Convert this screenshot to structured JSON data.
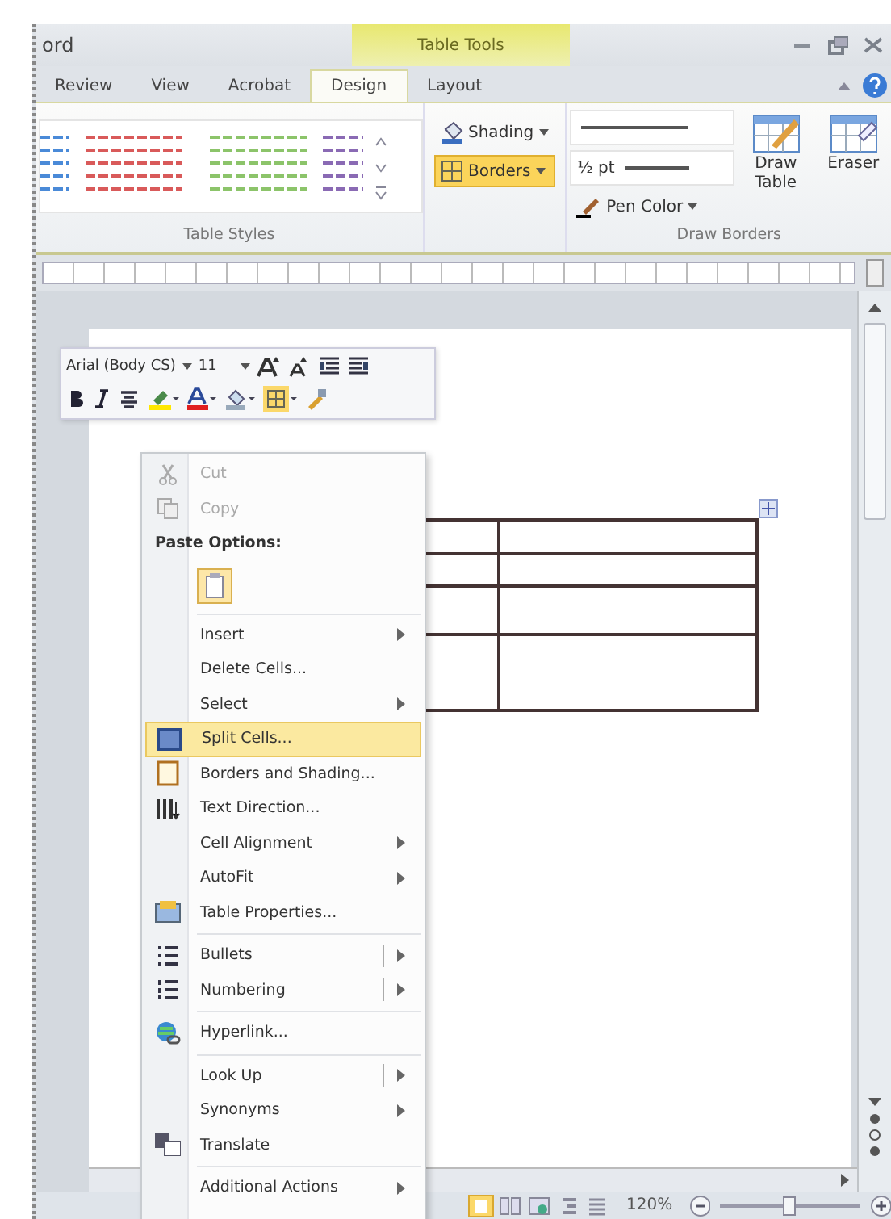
{
  "window": {
    "title": "ord",
    "context_tab": "Table Tools"
  },
  "tabs": [
    {
      "label": "Review",
      "selected": false
    },
    {
      "label": "View",
      "selected": false
    },
    {
      "label": "Acrobat",
      "selected": false
    },
    {
      "label": "Design",
      "selected": true
    },
    {
      "label": "Layout",
      "selected": false
    }
  ],
  "ribbon": {
    "table_styles_label": "Table Styles",
    "shading": {
      "label": "Shading",
      "selected": false
    },
    "borders": {
      "label": "Borders",
      "selected": true
    },
    "pen_weight": "½ pt",
    "pen_color": "Pen Color",
    "draw_table": "Draw Table",
    "eraser": "Eraser",
    "draw_borders_label": "Draw Borders"
  },
  "mini_toolbar": {
    "font": "Arial (Body CS)",
    "size": "11"
  },
  "context_menu": [
    {
      "kind": "item",
      "label": "Cut",
      "disabled": true,
      "submenu": false,
      "split": false,
      "selected": false
    },
    {
      "kind": "item",
      "label": "Copy",
      "disabled": true,
      "submenu": false,
      "split": false,
      "selected": false
    },
    {
      "kind": "header",
      "label": "Paste Options:"
    },
    {
      "kind": "paste"
    },
    {
      "kind": "separator"
    },
    {
      "kind": "item",
      "label": "Insert",
      "disabled": false,
      "submenu": true,
      "split": false,
      "selected": false
    },
    {
      "kind": "item",
      "label": "Delete Cells...",
      "disabled": false,
      "submenu": false,
      "split": false,
      "selected": false
    },
    {
      "kind": "item",
      "label": "Select",
      "disabled": false,
      "submenu": true,
      "split": false,
      "selected": false
    },
    {
      "kind": "item",
      "label": "Split Cells...",
      "disabled": false,
      "submenu": false,
      "split": false,
      "selected": true
    },
    {
      "kind": "item",
      "label": "Borders and Shading...",
      "disabled": false,
      "submenu": false,
      "split": false,
      "selected": false
    },
    {
      "kind": "item",
      "label": "Text Direction...",
      "disabled": false,
      "submenu": false,
      "split": false,
      "selected": false
    },
    {
      "kind": "item",
      "label": "Cell Alignment",
      "disabled": false,
      "submenu": true,
      "split": false,
      "selected": false
    },
    {
      "kind": "item",
      "label": "AutoFit",
      "disabled": false,
      "submenu": true,
      "split": false,
      "selected": false
    },
    {
      "kind": "item",
      "label": "Table Properties...",
      "disabled": false,
      "submenu": false,
      "split": false,
      "selected": false
    },
    {
      "kind": "separator"
    },
    {
      "kind": "item",
      "label": "Bullets",
      "disabled": false,
      "submenu": true,
      "split": true,
      "selected": false
    },
    {
      "kind": "item",
      "label": "Numbering",
      "disabled": false,
      "submenu": true,
      "split": true,
      "selected": false
    },
    {
      "kind": "separator"
    },
    {
      "kind": "item",
      "label": "Hyperlink...",
      "disabled": false,
      "submenu": false,
      "split": false,
      "selected": false
    },
    {
      "kind": "separator"
    },
    {
      "kind": "item",
      "label": "Look Up",
      "disabled": false,
      "submenu": true,
      "split": true,
      "selected": false
    },
    {
      "kind": "item",
      "label": "Synonyms",
      "disabled": false,
      "submenu": true,
      "split": false,
      "selected": false
    },
    {
      "kind": "item",
      "label": "Translate",
      "disabled": false,
      "submenu": false,
      "split": false,
      "selected": false
    },
    {
      "kind": "separator"
    },
    {
      "kind": "item",
      "label": "Additional Actions",
      "disabled": false,
      "submenu": true,
      "split": false,
      "selected": false
    }
  ],
  "status_bar": {
    "zoom": "120%",
    "zoom_slider": {
      "level": 0.5
    }
  }
}
